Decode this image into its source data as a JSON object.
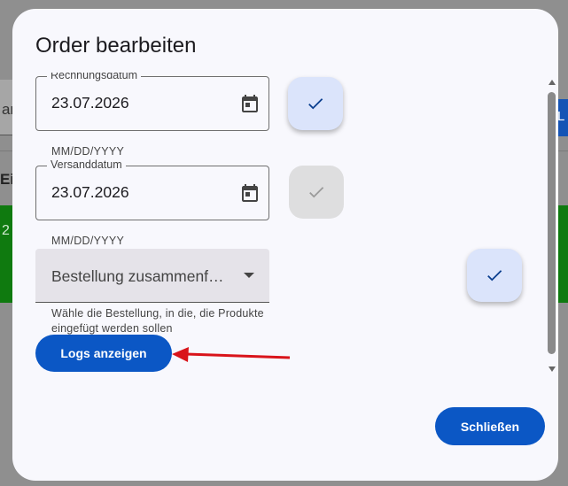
{
  "background": {
    "field_fragment": "ar",
    "bold_fragment": "Ei",
    "row_fragment": "2",
    "button_fragment": "L"
  },
  "dialog": {
    "title": "Order bearbeiten",
    "fields": [
      {
        "label": "Rechnungsdatum",
        "value": "23.07.2026",
        "hint": "MM/DD/YYYY",
        "checked": true
      },
      {
        "label": "Versanddatum",
        "value": "23.07.2026",
        "hint": "MM/DD/YYYY",
        "checked": false
      }
    ],
    "select": {
      "value": "Bestellung zusammenf…",
      "helper": "Wähle die Bestellung, in die, die Produkte eingefügt werden sollen",
      "checked": true
    },
    "logs_button": "Logs anzeigen",
    "close_button": "Schließen"
  },
  "colors": {
    "primary": "#0b57c5",
    "check_on_bg": "#dbe4fb",
    "check_off_bg": "#dededf",
    "annotation_arrow": "#d9141a",
    "background_row": "#0f7a0f"
  },
  "icons": [
    "calendar-icon",
    "check-icon",
    "dropdown-arrow-icon",
    "scroll-up-icon",
    "scroll-down-icon"
  ]
}
